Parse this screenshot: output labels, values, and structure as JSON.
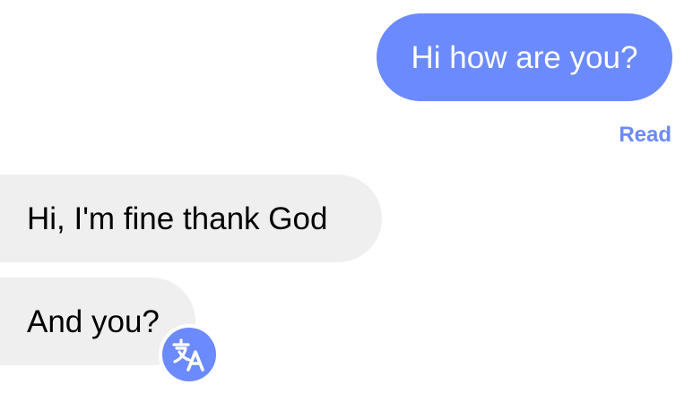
{
  "messages": {
    "sent": [
      {
        "text": "Hi how are you?"
      }
    ],
    "read_receipt": "Read",
    "received": [
      {
        "text": "Hi, I'm fine thank God"
      },
      {
        "text": "And you?"
      }
    ]
  },
  "icons": {
    "translate": "translate-icon"
  },
  "colors": {
    "accent": "#6b8afd",
    "received_bubble": "#efefef",
    "received_text": "#000000",
    "sent_text": "#ffffff",
    "background": "#ffffff"
  }
}
